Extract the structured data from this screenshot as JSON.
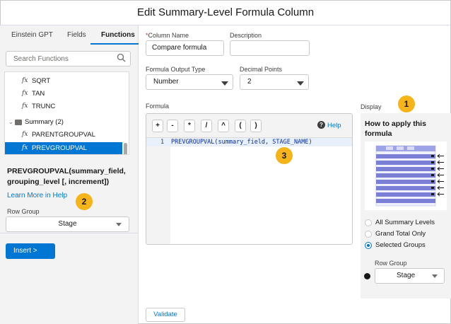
{
  "window": {
    "title": "Edit Summary-Level Formula Column"
  },
  "left_panel": {
    "tabs": [
      {
        "label": "Einstein GPT"
      },
      {
        "label": "Fields"
      },
      {
        "label": "Functions"
      }
    ],
    "search": {
      "placeholder": "Search Functions"
    },
    "functions": [
      {
        "label": "SQRT"
      },
      {
        "label": "TAN"
      },
      {
        "label": "TRUNC"
      },
      {
        "label": "Summary (2)"
      },
      {
        "label": "PARENTGROUPVAL"
      },
      {
        "label": "PREVGROUPVAL"
      }
    ],
    "fx_glyph": "fx",
    "signature": "PREVGROUPVAL(summary_field, grouping_level [, increment])",
    "learn_more": "Learn More in Help",
    "row_group": {
      "label": "Row Group",
      "value": "Stage"
    },
    "insert_label": "Insert  >"
  },
  "form": {
    "column_name": {
      "label": "Column Name",
      "required_marker": "*",
      "value": "Compare formula"
    },
    "description": {
      "label": "Description",
      "value": ""
    },
    "output_type": {
      "label": "Formula Output Type",
      "value": "Number"
    },
    "decimal_points": {
      "label": "Decimal Points",
      "value": "2"
    },
    "formula_label": "Formula",
    "operators": [
      "+",
      "-",
      "*",
      "/",
      "^",
      "(",
      ")"
    ],
    "help_label": "Help",
    "line_number": "1",
    "code": "PREVGROUPVAL(summary_field, STAGE_NAME)",
    "validate_label": "Validate"
  },
  "display": {
    "label": "Display",
    "heading": "How to apply this formula",
    "options": [
      {
        "label": "All Summary Levels",
        "selected": false
      },
      {
        "label": "Grand Total Only",
        "selected": false
      },
      {
        "label": "Selected Groups",
        "selected": true
      }
    ],
    "row_group": {
      "label": "Row Group",
      "value": "Stage"
    }
  },
  "callouts": [
    "1",
    "2",
    "3"
  ],
  "colors": {
    "accent": "#0176d3",
    "callout": "#f4b41a",
    "preview_rows": "#7b7fd6"
  }
}
